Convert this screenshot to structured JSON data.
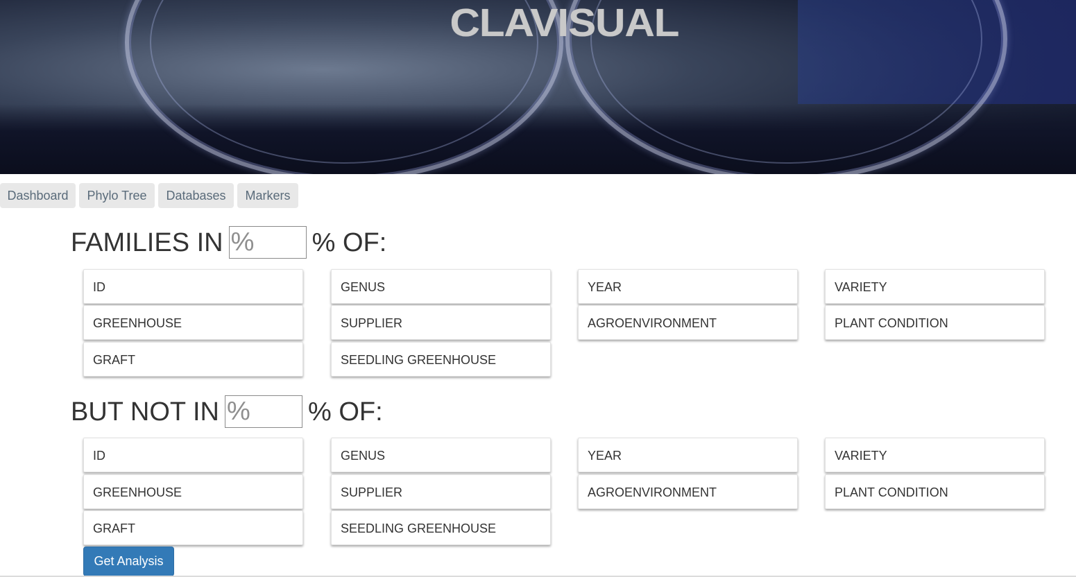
{
  "banner": {
    "logo_text": "CLAVISUAL"
  },
  "nav": {
    "tabs": [
      {
        "label": "Dashboard"
      },
      {
        "label": "Phylo Tree"
      },
      {
        "label": "Databases"
      },
      {
        "label": "Markers"
      }
    ]
  },
  "section_in": {
    "prefix": "FAMILIES IN",
    "input_placeholder": "%",
    "input_value": "",
    "suffix": "% OF:",
    "options": [
      "ID",
      "GENUS",
      "YEAR",
      "VARIETY",
      "GREENHOUSE",
      "SUPPLIER",
      "AGROENVIRONMENT",
      "PLANT CONDITION",
      "GRAFT",
      "SEEDLING GREENHOUSE"
    ]
  },
  "section_not_in": {
    "prefix": "BUT NOT IN",
    "input_placeholder": "%",
    "input_value": "",
    "suffix": "% OF:",
    "options": [
      "ID",
      "GENUS",
      "YEAR",
      "VARIETY",
      "GREENHOUSE",
      "SUPPLIER",
      "AGROENVIRONMENT",
      "PLANT CONDITION",
      "GRAFT",
      "SEEDLING GREENHOUSE"
    ]
  },
  "actions": {
    "get_analysis_label": "Get Analysis"
  }
}
